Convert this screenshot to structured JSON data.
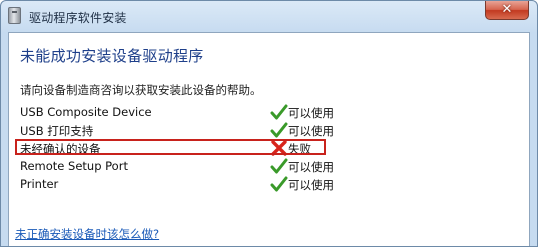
{
  "window": {
    "title": "驱动程序软件安装",
    "close_label": "✕"
  },
  "dialog": {
    "heading": "未能成功安装设备驱动程序",
    "instruction": "请向设备制造商咨询以获取安装此设备的帮助。",
    "devices": [
      {
        "name": "USB Composite Device",
        "status": "可以使用",
        "icon": "checkmark-icon"
      },
      {
        "name": "USB 打印支持",
        "status": "可以使用",
        "icon": "checkmark-icon"
      },
      {
        "name": "未经确认的设备",
        "status": "失败",
        "icon": "error-x-icon"
      },
      {
        "name": "Remote Setup Port",
        "status": "可以使用",
        "icon": "checkmark-icon"
      },
      {
        "name": "Printer",
        "status": "可以使用",
        "icon": "checkmark-icon"
      }
    ],
    "help_link": "未正确安装设备时该怎么做?"
  },
  "colors": {
    "heading": "#1e3f8a",
    "link": "#1a5ab8",
    "success": "#3a9a2a",
    "failure": "#d8251c",
    "highlight": "#c8221c"
  }
}
